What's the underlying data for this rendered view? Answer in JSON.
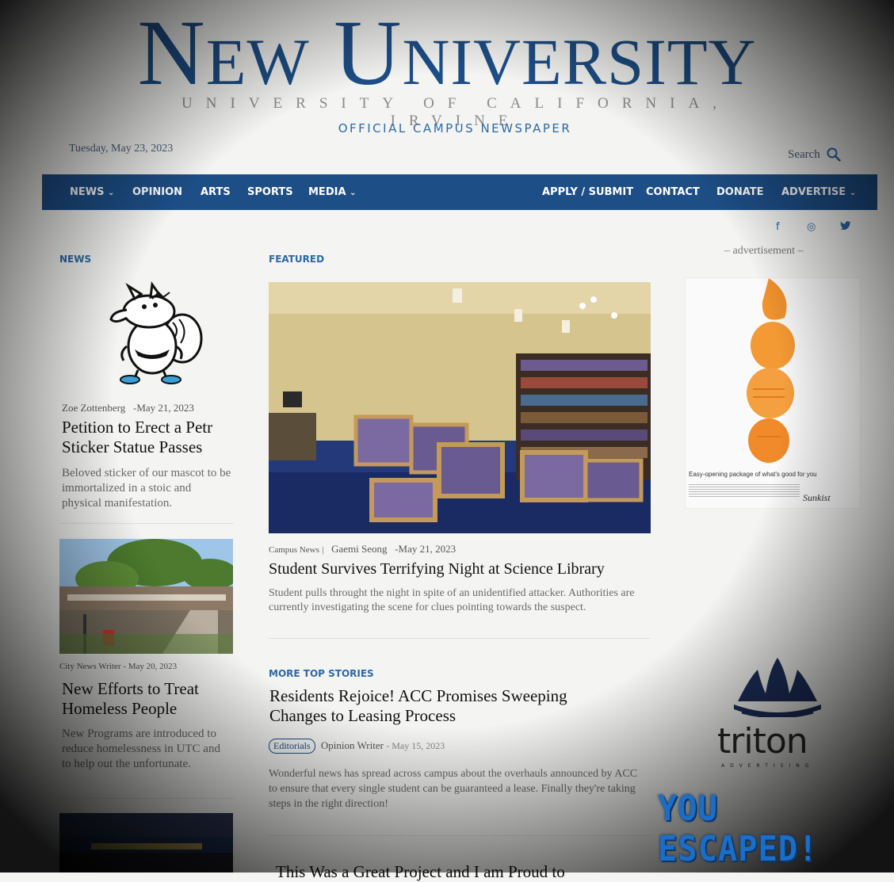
{
  "masthead": {
    "logo": "New University",
    "subtitle": "UNIVERSITY OF CALIFORNIA, IRVINE",
    "tagline": "OFFICIAL CAMPUS NEWSPAPER",
    "date": "Tuesday, May 23, 2023",
    "search_label": "Search"
  },
  "nav": {
    "left": [
      {
        "label": "NEWS",
        "dropdown": true
      },
      {
        "label": "OPINION",
        "dropdown": false
      },
      {
        "label": "ARTS",
        "dropdown": false
      },
      {
        "label": "SPORTS",
        "dropdown": false
      },
      {
        "label": "MEDIA",
        "dropdown": true
      }
    ],
    "right": [
      {
        "label": "APPLY / SUBMIT",
        "dropdown": false
      },
      {
        "label": "CONTACT",
        "dropdown": false
      },
      {
        "label": "DONATE",
        "dropdown": false
      },
      {
        "label": "ADVERTISE",
        "dropdown": true
      }
    ],
    "dropdown_glyph": "⌄"
  },
  "social": {
    "facebook": "f",
    "instagram": "◎",
    "twitter": "🐦"
  },
  "news_column": {
    "label": "NEWS",
    "articles": [
      {
        "author": "Zoe Zottenberg",
        "date": "-May 21, 2023",
        "title": "Petition to Erect a Petr Sticker Statue Passes",
        "excerpt": "Beloved sticker of our mascot to be immortalized in a stoic and physical manifestation."
      },
      {
        "author": "City News Writer",
        "date": "- May 20, 2023",
        "title": "New Efforts to Treat Homeless People",
        "excerpt": "New Programs are introduced to reduce homelessness in UTC and to help out the unfortunate."
      }
    ]
  },
  "featured": {
    "label": "FEATURED",
    "category": "Campus News",
    "separator": "|",
    "author": "Gaemi Seong",
    "date": "-May 21, 2023",
    "title": "Student Survives Terrifying Night at Science Library",
    "excerpt": "Student pulls throught the night in spite of an unidentified attacker. Authorities are currently investigating the scene for clues pointing towards the suspect."
  },
  "more_top": {
    "label": "MORE TOP STORIES",
    "title": "Residents Rejoice! ACC Promises Sweeping Changes to Leasing Process",
    "tag": "Editorials",
    "author": "Opinion Writer",
    "date": "- May 15, 2023",
    "excerpt": "Wonderful news has spread across campus about the overhauls announced by ACC to ensure that every single student can be guaranteed a lease. Finally they're taking steps in the right direction!",
    "next_title": "This Was a Great Project and I am Proud to"
  },
  "sidebar": {
    "ad_label": "– advertisement –",
    "ad_caption": "Easy-opening package of what's good for you",
    "ad_brand": "Sunkist",
    "triton_word": "triton",
    "triton_sub": "ADVERTISING"
  },
  "game": {
    "overlay_text": "YOU ESCAPED!"
  },
  "colors": {
    "brand": "#1d4e86",
    "accent": "#2b6aa6",
    "overlay": "#1a6ec8"
  }
}
